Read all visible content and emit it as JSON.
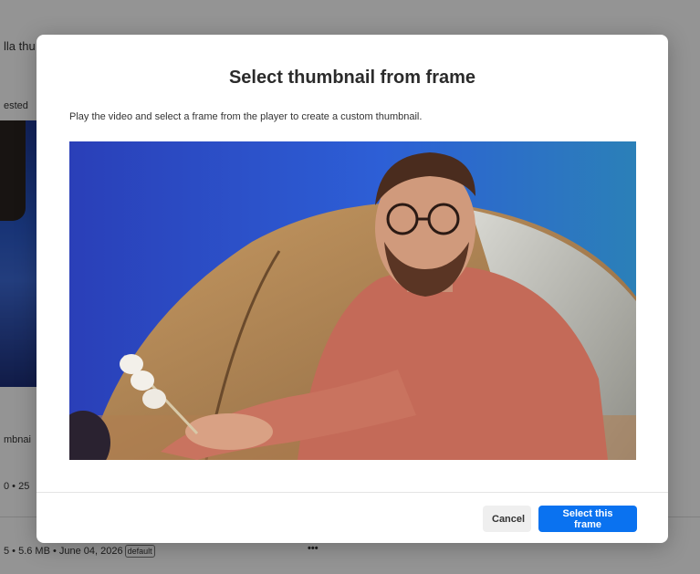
{
  "background": {
    "title_fragment": "lla thu",
    "label_fragment": "ested",
    "thumbnail_fragment": "mbnai",
    "meta_fragment": "0 • 25",
    "file_info": "5 • 5.6 MB • June 04, 2026",
    "default_badge": "default",
    "more_label": "•••"
  },
  "modal": {
    "title": "Select thumbnail from frame",
    "description": "Play the video and select a frame from the player to create a custom thumbnail.",
    "cancel_label": "Cancel",
    "select_label": "Select this frame"
  },
  "colors": {
    "primary": "#0a72f0",
    "video_background": "#2a47c4",
    "tent": "#b48a5a",
    "sweater": "#c96d5c"
  }
}
